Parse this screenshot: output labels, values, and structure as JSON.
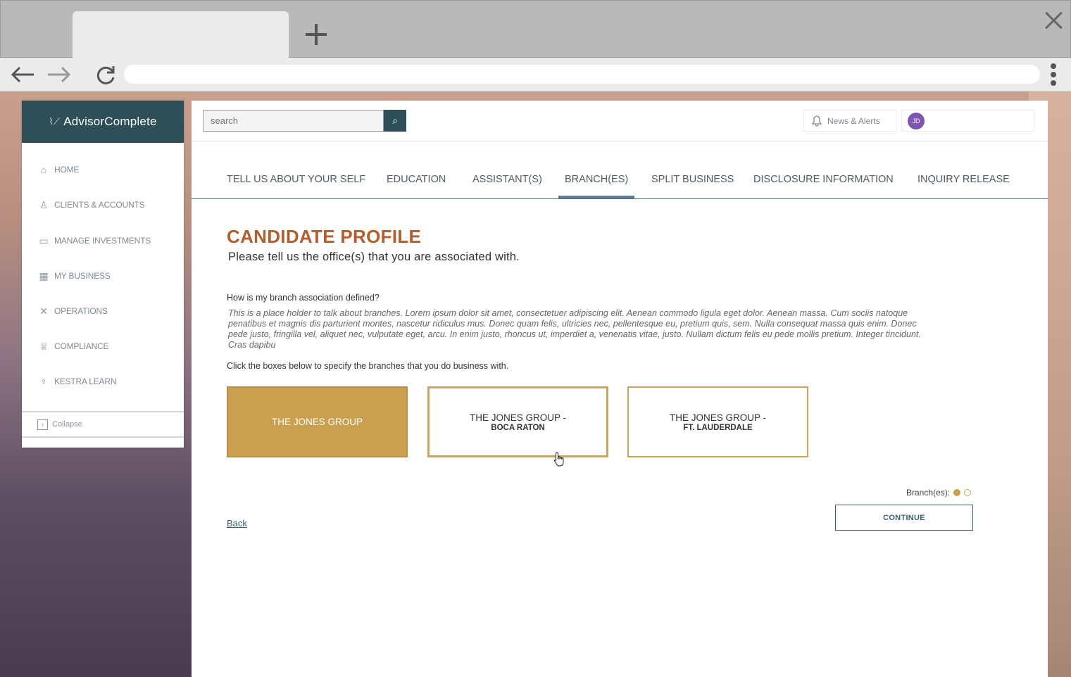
{
  "browser": {
    "tab_title": "",
    "url": ""
  },
  "app": {
    "brand": "AdvisorComplete"
  },
  "sidebar": {
    "items": [
      {
        "label": "HOME",
        "icon": "home-icon"
      },
      {
        "label": "CLIENTS & ACCOUNTS",
        "icon": "clients-icon"
      },
      {
        "label": "MANAGE INVESTMENTS",
        "icon": "investments-icon"
      },
      {
        "label": "MY BUSINESS",
        "icon": "business-icon"
      },
      {
        "label": "OPERATIONS",
        "icon": "operations-icon"
      },
      {
        "label": "COMPLIANCE",
        "icon": "compliance-icon"
      },
      {
        "label": "KESTRA LEARN",
        "icon": "lightbulb-icon"
      }
    ],
    "collapse_label": "Collapse"
  },
  "topbar": {
    "search_placeholder": "search",
    "news_label": "News & Alerts",
    "avatar_initials": "JD"
  },
  "tabs": [
    {
      "label": "TELL US ABOUT YOUR SELF",
      "active": false
    },
    {
      "label": "EDUCATION",
      "active": false
    },
    {
      "label": "ASSISTANT(S)",
      "active": false
    },
    {
      "label": "BRANCH(ES)",
      "active": true
    },
    {
      "label": "SPLIT BUSINESS",
      "active": false
    },
    {
      "label": "DISCLOSURE INFORMATION",
      "active": false
    },
    {
      "label": "INQUIRY RELEASE",
      "active": false
    }
  ],
  "content": {
    "title": "CANDIDATE PROFILE",
    "subtitle": "Please tell us the office(s) that you are associated with.",
    "question": "How is my branch association defined?",
    "paragraph": "This is a place holder to talk about branches. Lorem ipsum dolor sit amet, consectetuer adipiscing elit. Aenean commodo ligula eget dolor. Aenean massa. Cum sociis natoque penatibus et magnis dis parturient montes, nascetur ridiculus mus. Donec quam felis, ultricies nec, pellentesque eu, pretium quis, sem. Nulla consequat massa quis enim. Donec pede justo, fringilla vel, aliquet nec, vulputate eget, arcu. In enim justo, rhoncus ut, imperdiet a, venenatis vitae, justo. Nullam dictum felis eu pede mollis pretium. Integer tincidunt. Cras dapibu",
    "instruction": "Click the boxes below to specify the branches that you do business with.",
    "branches": [
      {
        "line1": "THE  JONES GROUP",
        "line2": "",
        "selected": true
      },
      {
        "line1": "THE  JONES GROUP -",
        "line2": "BOCA RATON",
        "selected": false
      },
      {
        "line1": "THE  JONES GROUP  -",
        "line2": "FT. LAUDERDALE",
        "selected": false
      }
    ],
    "branch_count_label": "Branch(es):",
    "branch_dots": {
      "selected": 1,
      "total": 2
    },
    "back_label": "Back",
    "continue_label": "CONTINUE"
  },
  "colors": {
    "accent": "#c9a050",
    "title": "#b05e30",
    "nav_dark": "#2e4e58",
    "link": "#3d5d75"
  }
}
